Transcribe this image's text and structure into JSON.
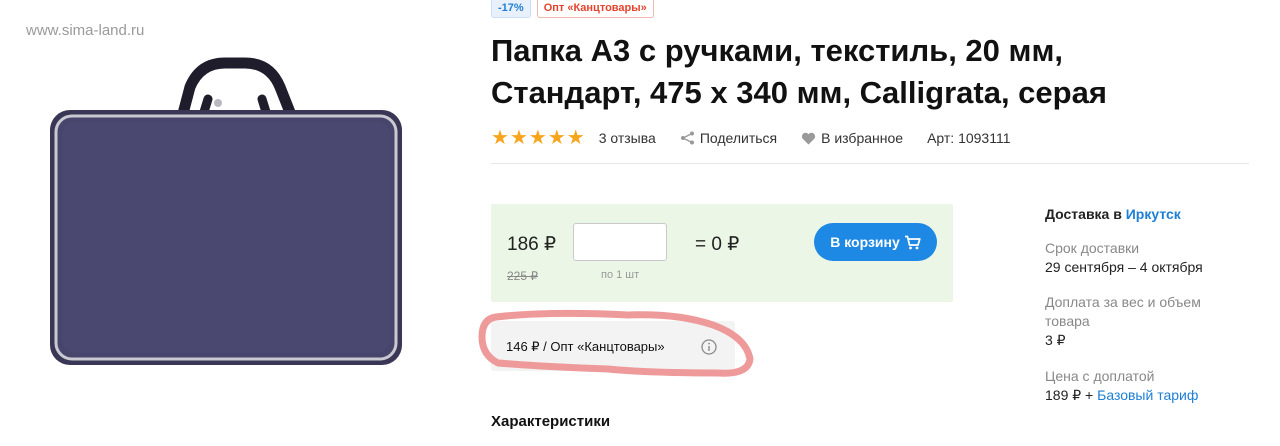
{
  "watermark": "www.sima-land.ru",
  "product": {
    "badges": {
      "discount": "-17%",
      "wholesale": "Опт «Канцтовары»"
    },
    "title": "Папка А3 с ручками, текстиль, 20 мм, Стандарт, 475 х 340 мм, Calligrata, серая",
    "rating": 5,
    "reviews": "3 отзыва",
    "share": "Поделиться",
    "favorite": "В избранное",
    "article": "Арт: 1093111"
  },
  "price": {
    "current": "186 ₽",
    "old": "225 ₽",
    "quantity_value": "",
    "quantity_caption": "по 1 шт",
    "total": "= 0 ₽",
    "cart_button": "В корзину"
  },
  "wholesale_offer": {
    "text": "146 ₽ / Опт «Канцтовары»"
  },
  "characteristics_title": "Характеристики",
  "delivery": {
    "title_prefix": "Доставка в",
    "city": "Иркутск",
    "term_label": "Срок доставки",
    "term_value": "29 сентября – 4 октября",
    "surcharge_label": "Доплата за вес и объем товара",
    "surcharge_value": "3 ₽",
    "price_label": "Цена с доплатой",
    "price_value": "189 ₽ +",
    "tariff_link": "Базовый тариф"
  },
  "colors": {
    "accent_blue": "#1e88e5",
    "price_box_bg": "#ecf6e6",
    "star": "#f7a51c",
    "discount_badge": "#1e7fd6",
    "opt_badge": "#e5432e",
    "highlight_marker": "#ef9a9a"
  },
  "icons": [
    "star-icon",
    "share-icon",
    "heart-icon",
    "cart-icon",
    "info-icon"
  ]
}
